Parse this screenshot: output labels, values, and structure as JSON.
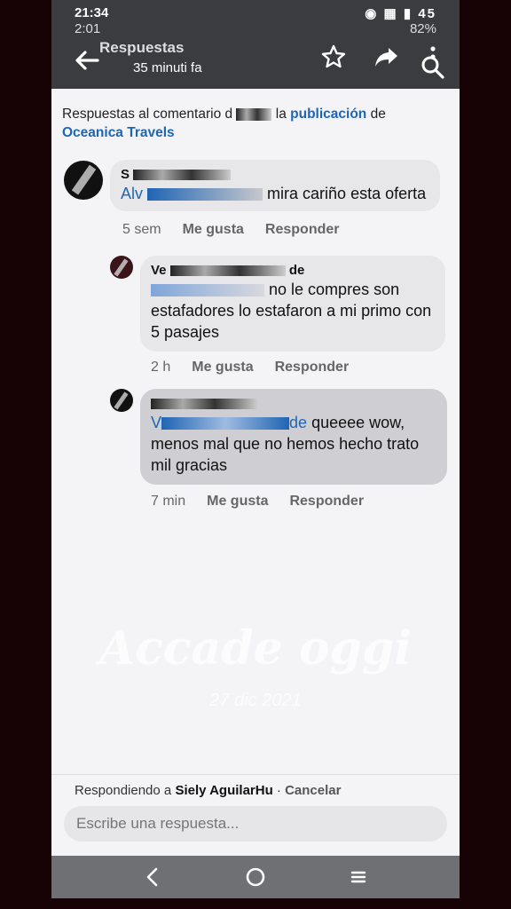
{
  "status_bar": {
    "time": "21:34",
    "battery": "45",
    "inner_time": "2:01",
    "inner_battery": "82%"
  },
  "header": {
    "title": "Respuestas",
    "subtitle": "35 minuti fa"
  },
  "context": {
    "prefix": "Respuestas al comentario d",
    "middle": "la",
    "link_publication": "publicación",
    "suffix": "de",
    "page_name": "Oceanica Travels"
  },
  "comments": [
    {
      "author": "S",
      "mention": "Alv",
      "text": "mira cariño esta oferta",
      "time": "5 sem",
      "like": "Me gusta",
      "reply": "Responder"
    },
    {
      "author": "Ve",
      "author_end": "de",
      "text": "no le compres son estafadores  lo estafaron a mi primo con 5 pasajes",
      "time": "2 h",
      "like": "Me gusta",
      "reply": "Responder"
    },
    {
      "author": "",
      "mention": "V",
      "mention_end": "de",
      "text_line1": "queeee wow,",
      "text_rest": "menos mal que no hemos hecho trato mil gracias",
      "time": "7 min",
      "like": "Me gusta",
      "reply": "Responder"
    }
  ],
  "watermark": {
    "title": "Accade oggi",
    "date": "27 dic 2021"
  },
  "reply_bar": {
    "replying_prefix": "Respondiendo a",
    "replying_name": "Siely AguilarHu",
    "separator": " · ",
    "cancel": "Cancelar",
    "placeholder": "Escribe una respuesta..."
  },
  "icons": [
    "back-arrow-icon",
    "star-icon",
    "share-icon",
    "search-icon",
    "more-icon",
    "nav-back-icon",
    "nav-home-icon",
    "nav-recents-icon"
  ]
}
